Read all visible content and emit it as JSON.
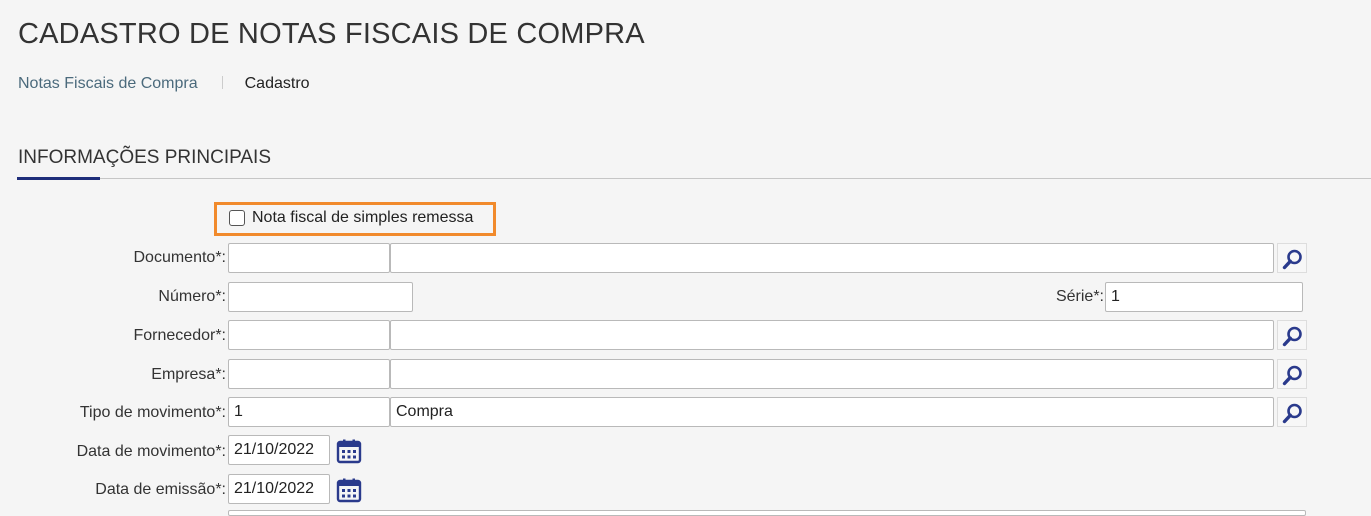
{
  "page": {
    "title": "CADASTRO DE NOTAS FISCAIS DE COMPRA"
  },
  "breadcrumb": {
    "items": [
      "Notas Fiscais de Compra",
      "Cadastro"
    ]
  },
  "section": {
    "title": "INFORMAÇÕES PRINCIPAIS"
  },
  "colors": {
    "accent": "#1f2e7a",
    "highlight": "#f18a2c",
    "link": "#4b6a7c",
    "icon": "#2a3a8c"
  },
  "form": {
    "simples_remessa": {
      "label": "Nota fiscal de simples remessa",
      "checked": false
    },
    "documento": {
      "label": "Documento*:",
      "code": "",
      "description": ""
    },
    "numero": {
      "label": "Número*:",
      "value": ""
    },
    "serie": {
      "label": "Série*:",
      "value": "1"
    },
    "fornecedor": {
      "label": "Fornecedor*:",
      "code": "",
      "description": ""
    },
    "empresa": {
      "label": "Empresa*:",
      "code": "",
      "description": ""
    },
    "tipo_movimento": {
      "label": "Tipo de movimento*:",
      "code": "1",
      "description": "Compra"
    },
    "data_movimento": {
      "label": "Data de movimento*:",
      "value": "21/10/2022"
    },
    "data_emissao": {
      "label": "Data de emissão*:",
      "value": "21/10/2022"
    }
  },
  "icons": {
    "search": "search-icon",
    "calendar": "calendar-icon",
    "checkbox": "checkbox-unchecked"
  }
}
